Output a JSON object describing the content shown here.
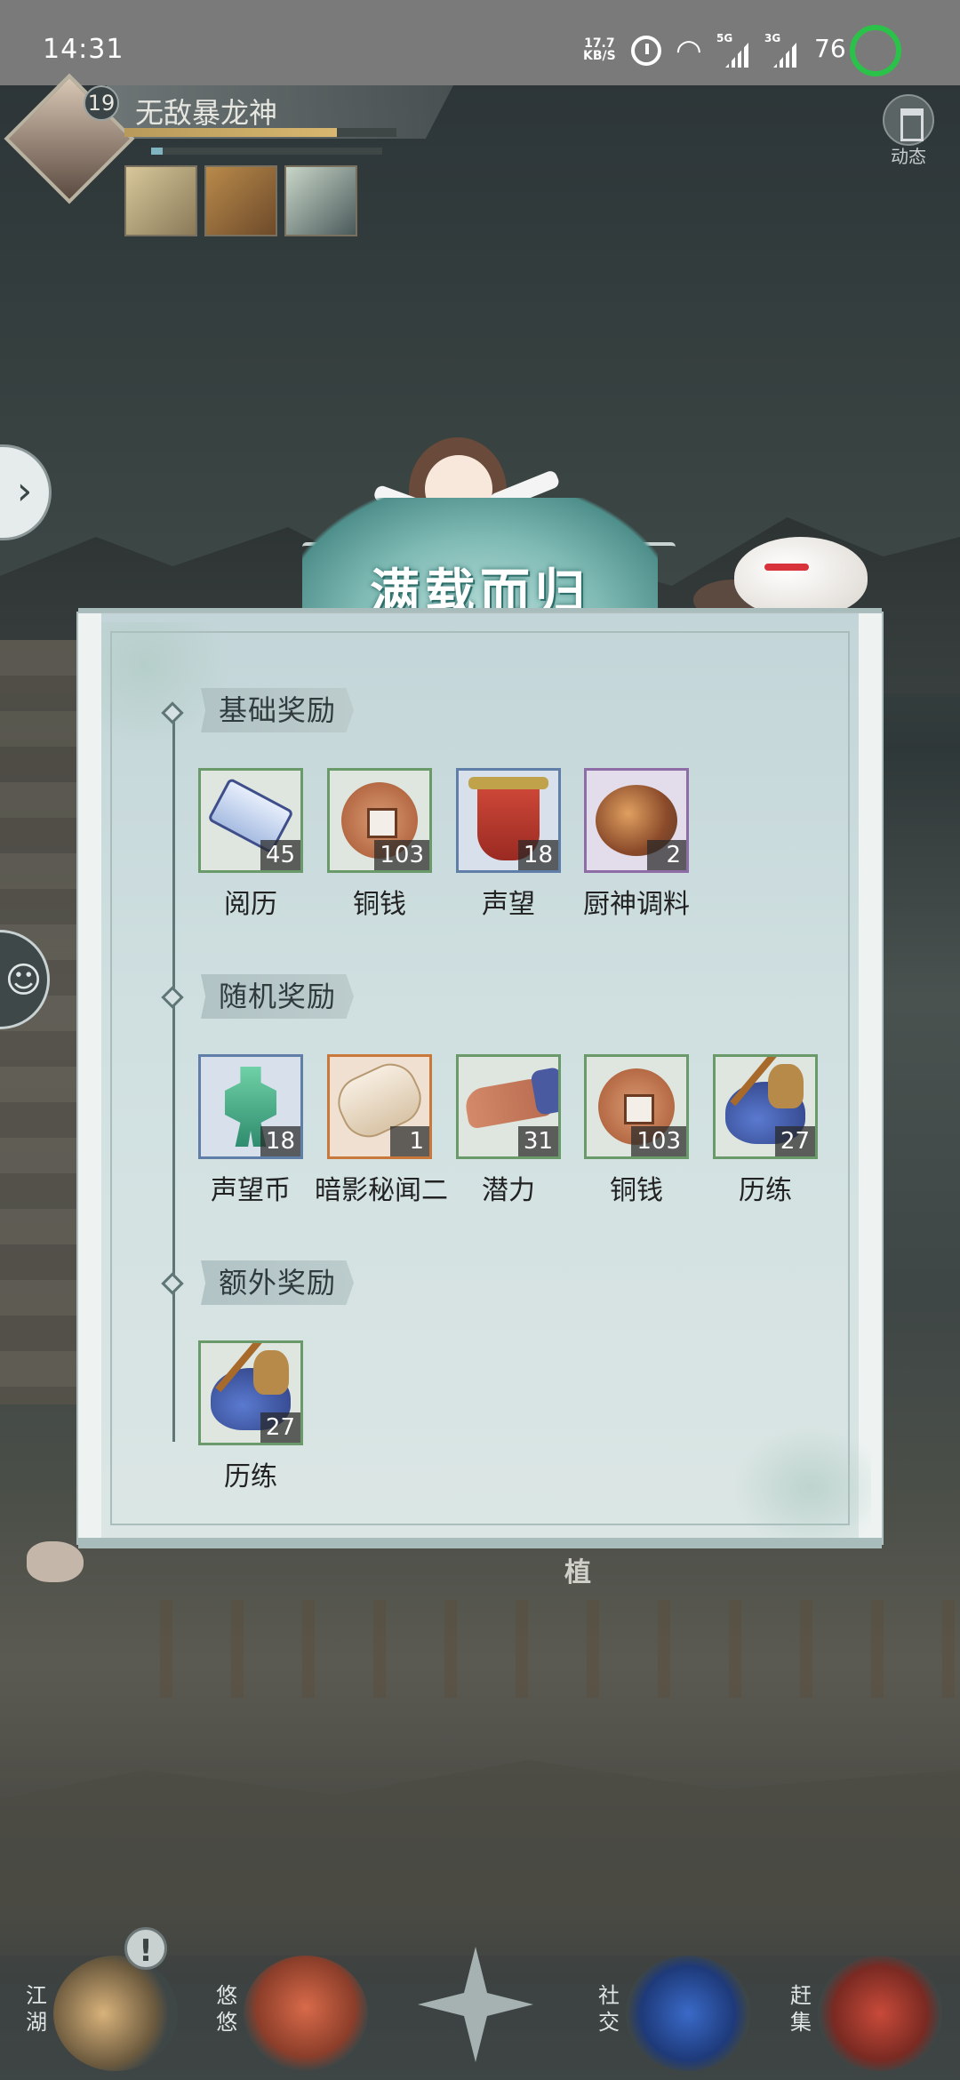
{
  "status_bar": {
    "time": "14:31",
    "net_speed_value": "17.7",
    "net_speed_unit": "KB/S",
    "signal1_label": "5G",
    "signal2_label": "3G",
    "battery": "76",
    "colors": {
      "ring": "#2bc24a"
    }
  },
  "player": {
    "level": "19",
    "name": "无敌暴龙神",
    "exp_fraction": 0.78,
    "sub_bar_fraction": 0.05
  },
  "top_right": {
    "dynamic_label": "动态"
  },
  "reward_popup": {
    "title": "满载而归",
    "sections": [
      {
        "label": "基础奖励",
        "items": [
          {
            "name": "阅历",
            "qty": "45",
            "icon": "scroll-icon",
            "rarity": "green"
          },
          {
            "name": "铜钱",
            "qty": "103",
            "icon": "copper-coin-icon",
            "rarity": "green"
          },
          {
            "name": "声望",
            "qty": "18",
            "icon": "reputation-banner-icon",
            "rarity": "blue"
          },
          {
            "name": "厨神调料",
            "qty": "2",
            "icon": "seasoning-icon",
            "rarity": "purple"
          }
        ]
      },
      {
        "label": "随机奖励",
        "items": [
          {
            "name": "声望币",
            "qty": "18",
            "icon": "jade-token-icon",
            "rarity": "blue"
          },
          {
            "name": "暗影秘闻二",
            "qty": "1",
            "icon": "secret-scroll-icon",
            "rarity": "orange"
          },
          {
            "name": "潜力",
            "qty": "31",
            "icon": "muscle-arm-icon",
            "rarity": "green"
          },
          {
            "name": "铜钱",
            "qty": "103",
            "icon": "copper-coin-icon",
            "rarity": "green"
          },
          {
            "name": "历练",
            "qty": "27",
            "icon": "travel-bundle-icon",
            "rarity": "green"
          }
        ]
      },
      {
        "label": "额外奖励",
        "items": [
          {
            "name": "历练",
            "qty": "27",
            "icon": "travel-bundle-icon",
            "rarity": "green"
          }
        ]
      }
    ]
  },
  "scene": {
    "plant_sign": "植"
  },
  "bottom_nav": {
    "items": [
      {
        "label": "江湖",
        "icon": "straw-hat-icon"
      },
      {
        "label": "悠悠",
        "icon": "bird-icon"
      },
      {
        "label": "社交",
        "icon": "wave-icon"
      },
      {
        "label": "赶集",
        "icon": "market-basket-icon"
      }
    ],
    "alert_symbol": "!"
  }
}
